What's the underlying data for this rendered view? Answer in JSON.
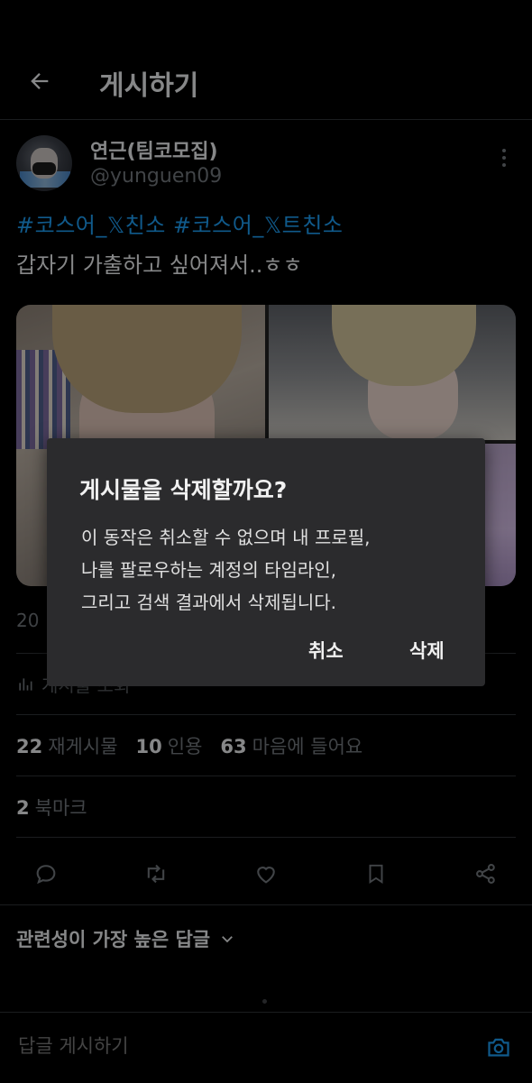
{
  "header": {
    "title": "게시하기"
  },
  "author": {
    "name": "연근(팀코모집)",
    "handle": "@yunguen09"
  },
  "tweet": {
    "hashtags": "#코스어_𝕏친소 #코스어_𝕏트친소",
    "text": "갑자기 가출하고 싶어져서..ㅎㅎ"
  },
  "meta": {
    "date_partial": "20",
    "views_partial": "게시물 조회"
  },
  "stats": [
    {
      "count": "22",
      "label": "재게시물"
    },
    {
      "count": "10",
      "label": "인용"
    },
    {
      "count": "63",
      "label": "마음에 들어요"
    }
  ],
  "bookmarks": {
    "count": "2",
    "label": "북마크"
  },
  "actions": [
    "reply-icon",
    "retweet-icon",
    "like-icon",
    "bookmark-icon",
    "share-icon"
  ],
  "replies": {
    "sort_label": "관련성이 가장 높은 답글"
  },
  "composer": {
    "placeholder": "답글 게시하기"
  },
  "dialog": {
    "title": "게시물을 삭제할까요?",
    "body_lines": [
      "이 동작은 취소할 수 없으며 내 프로필,",
      "나를 팔로우하는 계정의 타임라인,",
      "그리고 검색 결과에서 삭제됩니다."
    ],
    "cancel_label": "취소",
    "delete_label": "삭제"
  },
  "colors": {
    "accent": "#1d9bf0",
    "background": "#000000",
    "muted": "#71767b",
    "dialog": "#2b2b2d"
  }
}
